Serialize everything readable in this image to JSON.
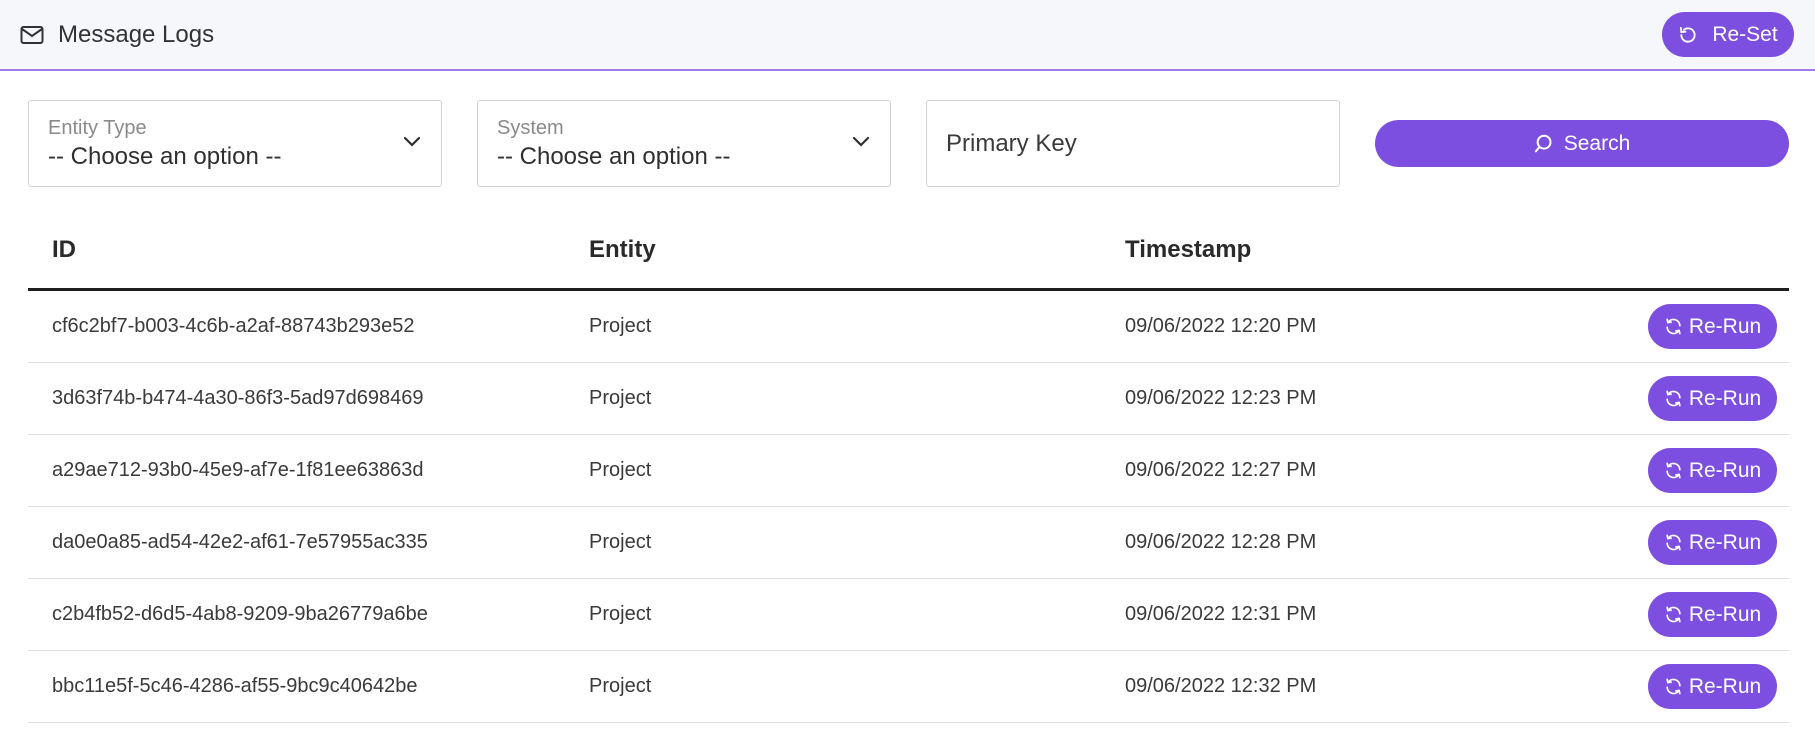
{
  "header": {
    "title": "Message Logs",
    "reset_label": "Re-Set"
  },
  "filters": {
    "entity_type": {
      "label": "Entity Type",
      "value": "-- Choose an option --"
    },
    "system": {
      "label": "System",
      "value": "-- Choose an option --"
    },
    "primary_key": {
      "placeholder": "Primary Key",
      "value": ""
    },
    "search_label": "Search"
  },
  "table": {
    "headers": [
      "ID",
      "Entity",
      "Timestamp"
    ],
    "rerun_label": "Re-Run",
    "rows": [
      {
        "id": "cf6c2bf7-b003-4c6b-a2af-88743b293e52",
        "entity": "Project",
        "timestamp": "09/06/2022 12:20 PM"
      },
      {
        "id": "3d63f74b-b474-4a30-86f3-5ad97d698469",
        "entity": "Project",
        "timestamp": "09/06/2022 12:23 PM"
      },
      {
        "id": "a29ae712-93b0-45e9-af7e-1f81ee63863d",
        "entity": "Project",
        "timestamp": "09/06/2022 12:27 PM"
      },
      {
        "id": "da0e0a85-ad54-42e2-af61-7e57955ac335",
        "entity": "Project",
        "timestamp": "09/06/2022 12:28 PM"
      },
      {
        "id": "c2b4fb52-d6d5-4ab8-9209-9ba26779a6be",
        "entity": "Project",
        "timestamp": "09/06/2022 12:31 PM"
      },
      {
        "id": "bbc11e5f-5c46-4286-af55-9bc9c40642be",
        "entity": "Project",
        "timestamp": "09/06/2022 12:32 PM"
      }
    ]
  },
  "colors": {
    "accent": "#7c4fe0",
    "header_bg": "#f6f7fb",
    "header_border": "#9b7fe6"
  },
  "icons": {
    "header": "envelope-icon",
    "reset": "undo-icon",
    "select": "chevron-down-icon",
    "search": "search-icon",
    "rerun": "refresh-icon"
  }
}
